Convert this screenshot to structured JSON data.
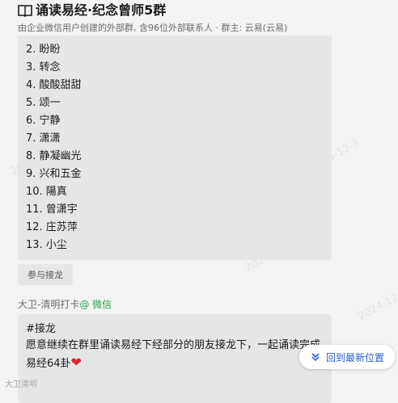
{
  "header": {
    "title": "诵读易经·纪念曾师5群",
    "subtitle": "由企业微信用户创建的外部群, 含96位外部联系人 · 群主: 云易(云易)"
  },
  "watermark_text": "2024-12-3",
  "list": [
    "2. 盼盼",
    "3. 转念",
    "4. 酸酸甜甜",
    "5. 颂一",
    "6. 宁静",
    "7. 潇潇",
    "8. 静凝幽光",
    "9. 兴和五金",
    "10. 陽真",
    "11. 曾潇宇",
    "12. 庄苏萍",
    "13. 小尘"
  ],
  "join_button": "参与接龙",
  "sender": {
    "name": "大卫-清明打卡",
    "source": "@ 微信"
  },
  "message": {
    "line1": "#接龙",
    "line2": "愿意继续在群里诵读易经下经部分的朋友接龙下，一起诵读完成",
    "line3": "易经64卦",
    "emoji": "❤"
  },
  "back_to_latest": "回到最新位置",
  "bottom_tag": "大卫清明"
}
